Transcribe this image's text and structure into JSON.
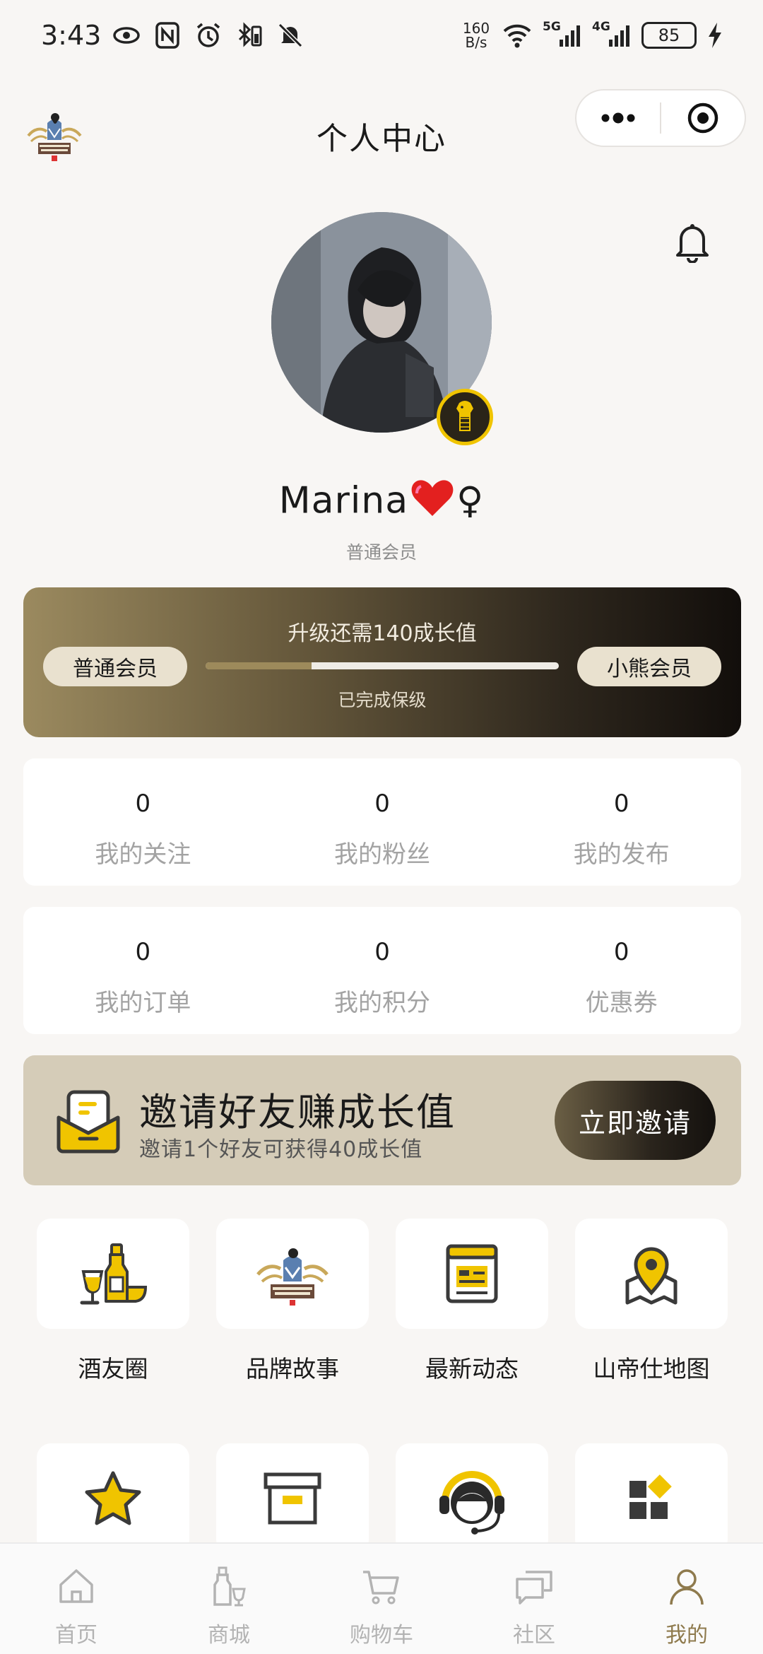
{
  "status_bar": {
    "time": "3:43",
    "net_speed_top": "160",
    "net_speed_bottom": "B/s",
    "signal_1": "5G",
    "signal_2": "4G",
    "battery": "85"
  },
  "header": {
    "title": "个人中心",
    "brand_logo_icon": "appenzeller-logo"
  },
  "profile": {
    "username": "Marina",
    "username_emoji": "❤️",
    "gender_symbol": "♀",
    "member_level": "普通会员"
  },
  "level_card": {
    "upgrade_text": "升级还需140成长值",
    "current_level": "普通会员",
    "next_level": "小熊会员",
    "progress_fraction": 0.3,
    "keep_text": "已完成保级"
  },
  "stats_row_1": [
    {
      "value": "0",
      "label": "我的关注"
    },
    {
      "value": "0",
      "label": "我的粉丝"
    },
    {
      "value": "0",
      "label": "我的发布"
    }
  ],
  "stats_row_2": [
    {
      "value": "0",
      "label": "我的订单"
    },
    {
      "value": "0",
      "label": "我的积分"
    },
    {
      "value": "0",
      "label": "优惠券"
    }
  ],
  "invite": {
    "title": "邀请好友赚成长值",
    "subtitle": "邀请1个好友可获得40成长值",
    "button": "立即邀请"
  },
  "grid_row_1": [
    {
      "label": "酒友圈",
      "icon": "drinks-icon"
    },
    {
      "label": "品牌故事",
      "icon": "brand-logo-icon"
    },
    {
      "label": "最新动态",
      "icon": "news-icon"
    },
    {
      "label": "山帝仕地图",
      "icon": "map-pin-icon"
    }
  ],
  "grid_row_2": [
    {
      "icon": "star-icon"
    },
    {
      "icon": "box-icon"
    },
    {
      "icon": "customer-service-icon"
    },
    {
      "icon": "apps-icon"
    }
  ],
  "bottom_nav": [
    {
      "label": "首页",
      "icon": "home-icon"
    },
    {
      "label": "商城",
      "icon": "bottles-icon"
    },
    {
      "label": "购物车",
      "icon": "cart-icon"
    },
    {
      "label": "社区",
      "icon": "chat-icon"
    },
    {
      "label": "我的",
      "icon": "user-icon",
      "active": true
    }
  ],
  "colors": {
    "accent_gold": "#f0c400",
    "brand_brown": "#8e7a4d",
    "background": "#f8f6f4"
  }
}
